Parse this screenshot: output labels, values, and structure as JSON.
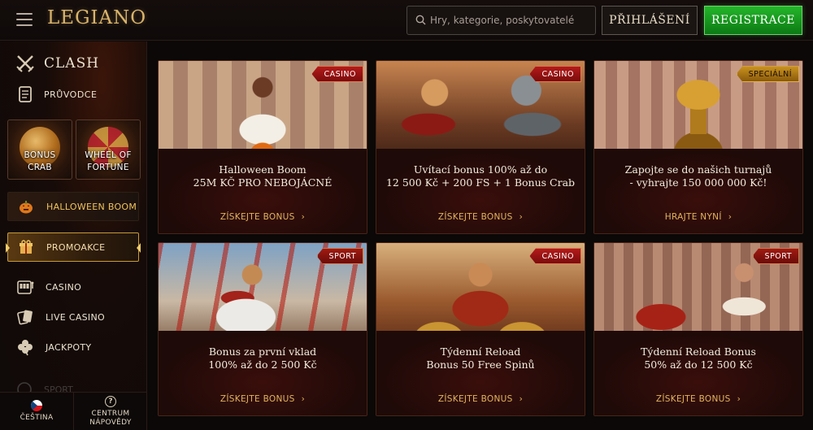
{
  "header": {
    "logo": "LEGIANO",
    "search_placeholder": "Hry, kategorie, poskytovatelé",
    "login_label": "PŘIHLÁŠENÍ",
    "register_label": "REGISTRACE",
    "colors": {
      "accent_gold": "#d9b46a",
      "register_green": "#1a9a22"
    }
  },
  "sidebar": {
    "clash": {
      "label": "CLASH",
      "icon": "crossed-swords-icon"
    },
    "guide": {
      "label": "PRŮVODCE",
      "icon": "scroll-icon"
    },
    "tiles": [
      {
        "label_line1": "BONUS",
        "label_line2": "CRAB"
      },
      {
        "label_line1": "WHEEL OF",
        "label_line2": "FORTUNE"
      }
    ],
    "items": [
      {
        "label": "HALLOWEEN BOOM",
        "icon": "pumpkin-icon"
      },
      {
        "label": "PROMOAKCE",
        "icon": "gift-icon"
      },
      {
        "label": "CASINO",
        "icon": "slot-machine-icon"
      },
      {
        "label": "LIVE CASINO",
        "icon": "playing-cards-icon"
      },
      {
        "label": "JACKPOTY",
        "icon": "clover-icon"
      },
      {
        "label": "SPORT",
        "icon": "ball-icon"
      }
    ],
    "bottom": {
      "language": "ČEŠTINA",
      "help_line1": "CENTRUM",
      "help_line2": "NÁPOVĚDY"
    }
  },
  "cards": [
    {
      "badge": "CASINO",
      "title_line1": "Halloween Boom",
      "title_line2": "25M KČ PRO NEBOJÁCNÉ",
      "cta": "ZÍSKEJTE BONUS"
    },
    {
      "badge": "CASINO",
      "title_line1": "Uvítací bonus 100% až do",
      "title_line2": "12 500 Kč + 200 FS + 1 Bonus Crab",
      "cta": "ZÍSKEJTE BONUS"
    },
    {
      "badge": "SPECIÁLNÍ",
      "title_line1": "Zapojte se do našich turnajů",
      "title_line2": "- vyhrajte 150 000 000 Kč!",
      "cta": "HRAJTE NYNÍ"
    },
    {
      "badge": "SPORT",
      "title_line1": "Bonus za první vklad",
      "title_line2": "100% až do 2 500 Kč",
      "cta": "ZÍSKEJTE BONUS"
    },
    {
      "badge": "CASINO",
      "title_line1": "Týdenní Reload",
      "title_line2": "Bonus 50 Free Spinů",
      "cta": "ZÍSKEJTE BONUS"
    },
    {
      "badge": "SPORT",
      "title_line1": "Týdenní Reload Bonus",
      "title_line2": "50% až do 12 500 Kč",
      "cta": "ZÍSKEJTE BONUS"
    }
  ]
}
